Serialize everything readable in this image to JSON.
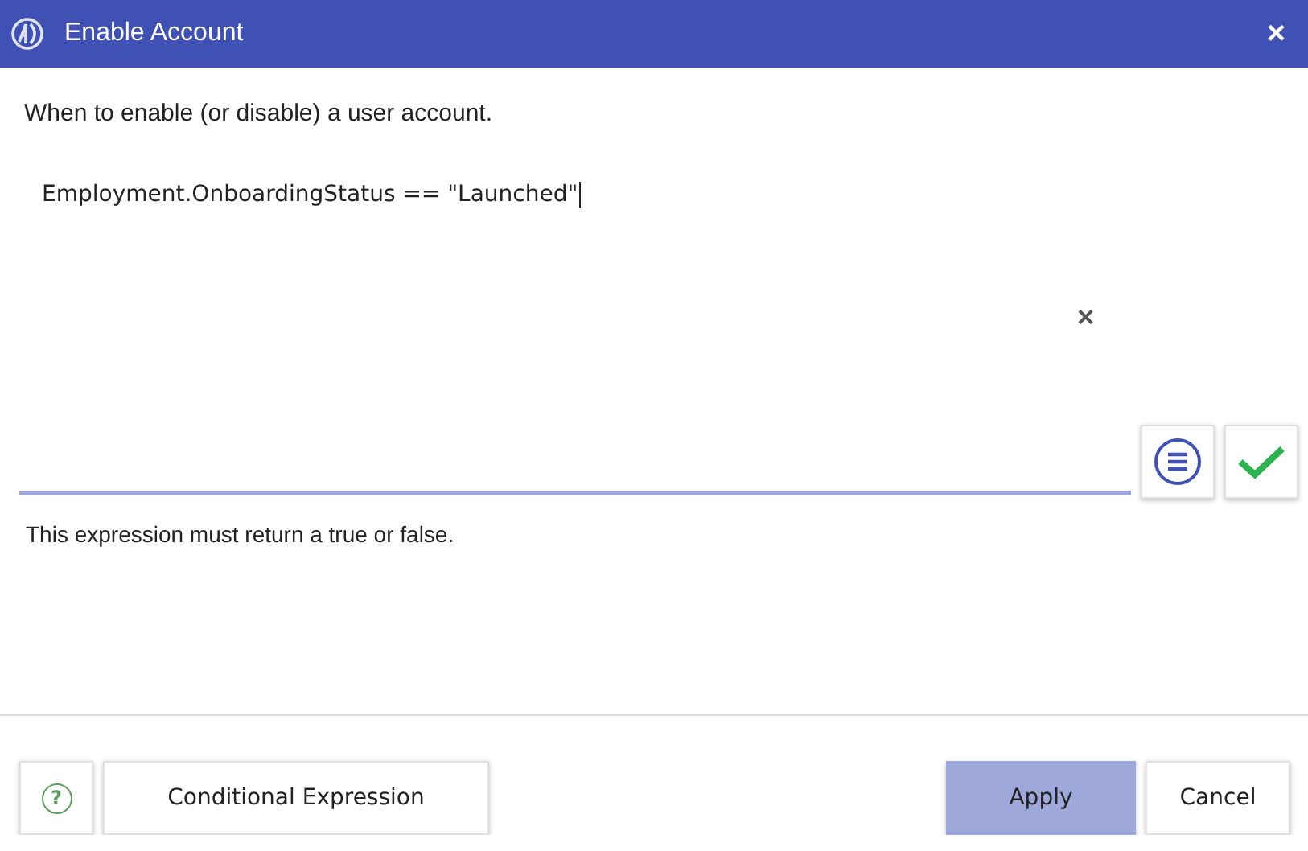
{
  "window": {
    "title": "Enable Account",
    "close": "×"
  },
  "description": "When to enable (or disable) a user account.",
  "editor": {
    "value": "Employment.OnboardingStatus == \"Launched\"",
    "clear": "×"
  },
  "hint": "This expression must return a true or false.",
  "footer": {
    "left": [
      {
        "kind": "help",
        "label": "?"
      },
      {
        "kind": "normal",
        "label": "Conditional Expression"
      }
    ],
    "right": [
      {
        "kind": "primary",
        "label": "Apply"
      },
      {
        "kind": "normal",
        "label": "Cancel"
      }
    ]
  }
}
